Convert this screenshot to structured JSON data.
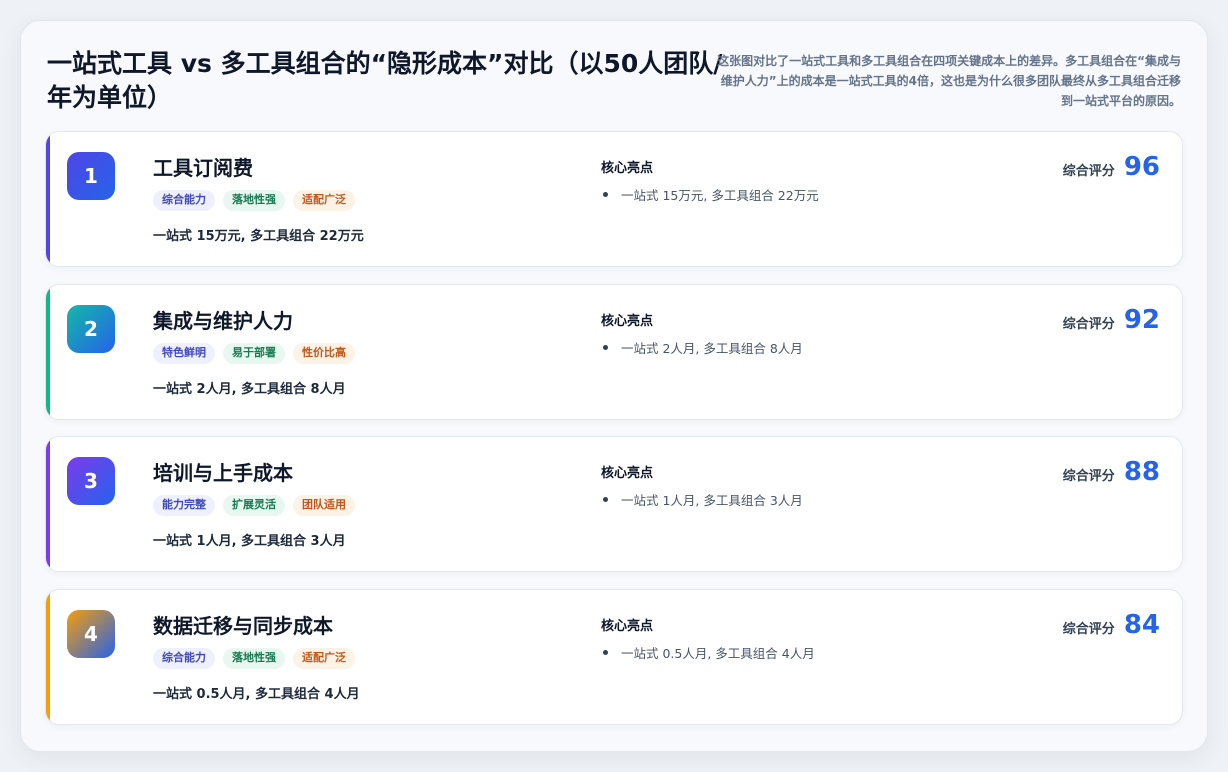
{
  "header": {
    "title": "一站式工具 vs 多工具组合的“隐形成本”对比（以50人团队/年为单位）",
    "description": "这张图对比了一站式工具和多工具组合在四项关键成本上的差异。多工具组合在“集成与维护人力”上的成本是一站式工具的4倍，这也是为什么很多团队最终从多工具组合迁移到一站式平台的原因。"
  },
  "cards": [
    {
      "rank": "1",
      "title": "工具订阅费",
      "tags": [
        "综合能力",
        "落地性强",
        "适配广泛"
      ],
      "summary": "一站式 15万元, 多工具组合 22万元",
      "highlight_title": "核心亮点",
      "highlight": "一站式 15万元, 多工具组合 22万元",
      "score_label": "综合评分",
      "score": "96",
      "accent": "#4f46e5",
      "badge_from": "#4f46e5",
      "badge_to": "#2563eb"
    },
    {
      "rank": "2",
      "title": "集成与维护人力",
      "tags": [
        "特色鲜明",
        "易于部署",
        "性价比高"
      ],
      "summary": "一站式 2人月, 多工具组合 8人月",
      "highlight_title": "核心亮点",
      "highlight": "一站式 2人月, 多工具组合 8人月",
      "score_label": "综合评分",
      "score": "92",
      "accent": "#10b981",
      "badge_from": "#14b8a6",
      "badge_to": "#2563eb"
    },
    {
      "rank": "3",
      "title": "培训与上手成本",
      "tags": [
        "能力完整",
        "扩展灵活",
        "团队适用"
      ],
      "summary": "一站式 1人月, 多工具组合 3人月",
      "highlight_title": "核心亮点",
      "highlight": "一站式 1人月, 多工具组合 3人月",
      "score_label": "综合评分",
      "score": "88",
      "accent": "#7c3aed",
      "badge_from": "#7c3aed",
      "badge_to": "#2563eb"
    },
    {
      "rank": "4",
      "title": "数据迁移与同步成本",
      "tags": [
        "综合能力",
        "落地性强",
        "适配广泛"
      ],
      "summary": "一站式 0.5人月, 多工具组合 4人月",
      "highlight_title": "核心亮点",
      "highlight": "一站式 0.5人月, 多工具组合 4人月",
      "score_label": "综合评分",
      "score": "84",
      "accent": "#f59e0b",
      "badge_from": "#f59e0b",
      "badge_to": "#2563eb"
    }
  ]
}
